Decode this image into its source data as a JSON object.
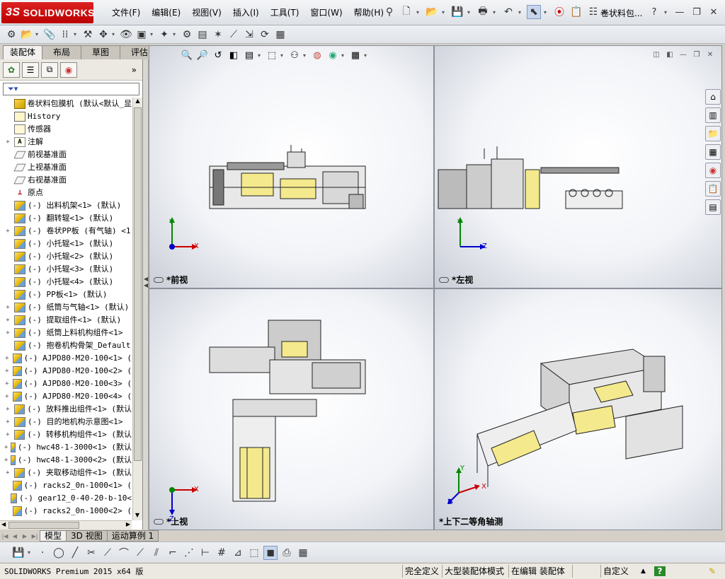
{
  "app": {
    "logo_text": "SOLIDWORKS",
    "logo_prefix": "3S",
    "document_title": "卷状料包..."
  },
  "menu": [
    "文件(F)",
    "编辑(E)",
    "视图(V)",
    "插入(I)",
    "工具(T)",
    "窗口(W)",
    "帮助(H)"
  ],
  "cm_tabs": [
    "装配体",
    "布局",
    "草图",
    "评估"
  ],
  "active_cm_tab": "装配体",
  "panel": {
    "more_label": "»",
    "filter_icon": "filter-icon"
  },
  "tree": [
    {
      "label": "卷状料包膜机  (默认<默认_显",
      "icon": "assembly",
      "expand": ""
    },
    {
      "label": "History",
      "icon": "history",
      "expand": ""
    },
    {
      "label": "传感器",
      "icon": "sensor",
      "expand": ""
    },
    {
      "label": "注解",
      "icon": "annot",
      "expand": "+"
    },
    {
      "label": "前视基准面",
      "icon": "plane",
      "expand": ""
    },
    {
      "label": "上视基准面",
      "icon": "plane",
      "expand": ""
    },
    {
      "label": "右视基准面",
      "icon": "plane",
      "expand": ""
    },
    {
      "label": "原点",
      "icon": "origin",
      "expand": ""
    },
    {
      "label": "(-) 出料机架<1> (默认)",
      "icon": "component",
      "expand": ""
    },
    {
      "label": "(-) 翻转辊<1> (默认)",
      "icon": "component",
      "expand": ""
    },
    {
      "label": "(-) 卷状PP板 (有气轴) <1",
      "icon": "component",
      "expand": "+"
    },
    {
      "label": "(-) 小托辊<1> (默认)",
      "icon": "component",
      "expand": ""
    },
    {
      "label": "(-) 小托辊<2> (默认)",
      "icon": "component",
      "expand": ""
    },
    {
      "label": "(-) 小托辊<3> (默认)",
      "icon": "component",
      "expand": ""
    },
    {
      "label": "(-) 小托辊<4> (默认)",
      "icon": "component",
      "expand": ""
    },
    {
      "label": "(-) PP板<1> (默认)",
      "icon": "component",
      "expand": ""
    },
    {
      "label": "(-) 纸筒与气轴<1> (默认)",
      "icon": "component",
      "expand": "+"
    },
    {
      "label": "(-) 提取组件<1> (默认)",
      "icon": "component",
      "expand": "+"
    },
    {
      "label": "(-) 纸筒上料机构组件<1>",
      "icon": "component",
      "expand": "+"
    },
    {
      "label": "(-) 抱卷机构骨架_Default",
      "icon": "component",
      "expand": ""
    },
    {
      "label": "(-) AJPD80-M20-100<1> (",
      "icon": "component",
      "expand": "+"
    },
    {
      "label": "(-) AJPD80-M20-100<2> (",
      "icon": "component",
      "expand": "+"
    },
    {
      "label": "(-) AJPD80-M20-100<3> (",
      "icon": "component",
      "expand": "+"
    },
    {
      "label": "(-) AJPD80-M20-100<4> (",
      "icon": "component",
      "expand": "+"
    },
    {
      "label": "(-) 放料推出组件<1> (默认",
      "icon": "component",
      "expand": "+"
    },
    {
      "label": "(-) 目的地机构示意图<1>",
      "icon": "component",
      "expand": "+"
    },
    {
      "label": "(-) 转移机构组件<1> (默认",
      "icon": "component",
      "expand": "+"
    },
    {
      "label": "(-) hwc48-1-3000<1> (默认",
      "icon": "component",
      "expand": "+"
    },
    {
      "label": "(-) hwc48-1-3000<2> (默认",
      "icon": "component",
      "expand": "+"
    },
    {
      "label": "(-) 夹取移动组件<1> (默认",
      "icon": "component",
      "expand": "+"
    },
    {
      "label": "(-) racks2_0n-1000<1> (",
      "icon": "component",
      "expand": ""
    },
    {
      "label": "(-) gear12_0-40-20-b-10<",
      "icon": "component",
      "expand": ""
    },
    {
      "label": "(-) racks2_0n-1000<2> (",
      "icon": "component",
      "expand": ""
    }
  ],
  "viewports": {
    "front": {
      "label": "*前视",
      "x": "X",
      "y": "Y"
    },
    "left": {
      "label": "*左视",
      "y": "Y",
      "z": "Z"
    },
    "top": {
      "label": "*上视",
      "x": "X",
      "z": "Z"
    },
    "iso": {
      "label": "*上下二等角轴测",
      "x": "X",
      "y": "Y",
      "z": "Z"
    }
  },
  "model_tabs": [
    "模型",
    "3D 视图",
    "运动算例 1"
  ],
  "active_model_tab": "模型",
  "status": {
    "product": "SOLIDWORKS Premium 2015 x64 版",
    "definition": "完全定义",
    "mode": "大型装配体模式",
    "editing": "在编辑 装配体",
    "units": "自定义",
    "help": "?"
  },
  "colors": {
    "brand": "#cc1111",
    "viewport_bg": "#f2f4f8",
    "axis_x": "#cc0000",
    "axis_y": "#008800",
    "axis_z": "#0000cc",
    "material_yellow": "#f4e98c"
  }
}
